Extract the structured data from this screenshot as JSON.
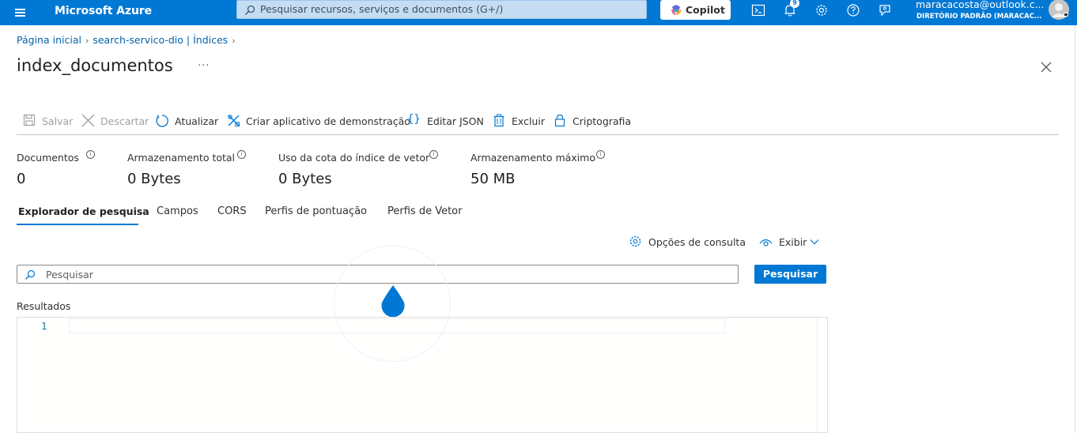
{
  "topbar": {
    "brand": "Microsoft Azure",
    "search_placeholder": "Pesquisar recursos, serviços e documentos (G+/)",
    "copilot_label": "Copilot",
    "notification_count": "9",
    "account_email": "maracacosta@outlook.c...",
    "account_directory": "DIRETÓRIO PADRÃO (MARACAC..."
  },
  "breadcrumb": [
    "Página inicial",
    "search-servico-dio | Índices"
  ],
  "page_title": "index_documentos",
  "more_label": "···",
  "toolbar": {
    "save": "Salvar",
    "discard": "Descartar",
    "refresh": "Atualizar",
    "demo_app": "Criar aplicativo de demonstração",
    "edit_json": "Editar JSON",
    "delete": "Excluir",
    "encryption": "Criptografia"
  },
  "stats": [
    {
      "label": "Documentos",
      "value": "0"
    },
    {
      "label": "Armazenamento total",
      "value": "0 Bytes"
    },
    {
      "label": "Uso da cota do índice de vetor",
      "value": "0 Bytes"
    },
    {
      "label": "Armazenamento máximo",
      "value": "50 MB"
    }
  ],
  "info_glyph": "i",
  "tabs": [
    "Explorador de pesquisa",
    "Campos",
    "CORS",
    "Perfis de pontuação",
    "Perfis de Vetor"
  ],
  "active_tab": "Explorador de pesquisa",
  "query_options_label": "Opções de consulta",
  "view_label": "Exibir",
  "search": {
    "placeholder": "Pesquisar",
    "button_label": "Pesquisar"
  },
  "results_label": "Resultados",
  "editor": {
    "line_number": "1"
  },
  "colors": {
    "accent": "#0078d4",
    "topbar": "#0078d4",
    "link": "#0062ad"
  },
  "icons": [
    "hamburger-icon",
    "search-icon",
    "copilot-icon",
    "cloud-shell-icon",
    "bell-icon",
    "gear-icon",
    "help-icon",
    "feedback-icon",
    "avatar",
    "close-icon",
    "save-icon",
    "discard-icon",
    "refresh-icon",
    "demo-app-icon",
    "json-braces-icon",
    "trash-icon",
    "lock-icon",
    "info-icon",
    "eye-icon",
    "chevron-down-icon",
    "loading-drop-icon"
  ]
}
